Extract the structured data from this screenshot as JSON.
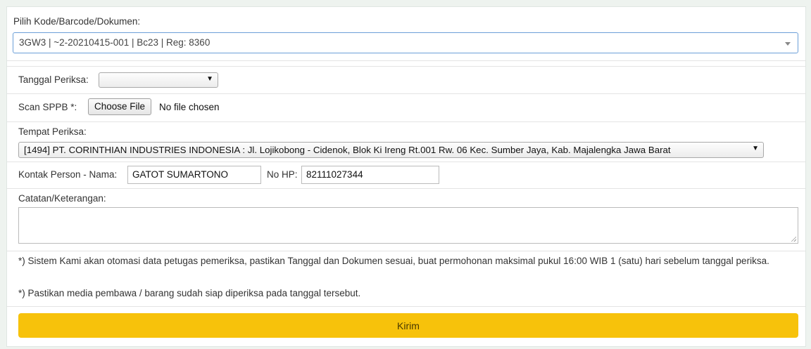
{
  "form": {
    "kode_label": "Pilih Kode/Barcode/Dokumen:",
    "kode_value": "3GW3 | ~2-20210415-001 | Bc23 | Reg: 8360",
    "tanggal_label": "Tanggal Periksa:",
    "tanggal_value": "",
    "scan_label": "Scan SPPB *:",
    "choose_file": "Choose File",
    "no_file": "No file chosen",
    "tempat_label": "Tempat Periksa:",
    "tempat_value": "[1494] PT. CORINTHIAN INDUSTRIES INDONESIA : Jl. Lojikobong - Cidenok, Blok Ki Ireng Rt.001 Rw. 06 Kec. Sumber Jaya, Kab. Majalengka Jawa Barat",
    "kontak_label": "Kontak Person - Nama:",
    "kontak_value": "GATOT SUMARTONO",
    "hp_label": "No HP:",
    "hp_value": "82111027344",
    "catatan_label": "Catatan/Keterangan:",
    "catatan_value": "",
    "note1": "*) Sistem Kami akan otomasi data petugas pemeriksa, pastikan Tanggal dan Dokumen sesuai, buat permohonan maksimal pukul 16:00 WIB 1 (satu) hari sebelum tanggal periksa.",
    "note2": "*) Pastikan media pembawa / barang sudah siap diperiksa pada tanggal tersebut.",
    "submit_label": "Kirim"
  },
  "colors": {
    "submit_bg": "#f7c20b",
    "focus_border": "#6b9fd8"
  }
}
